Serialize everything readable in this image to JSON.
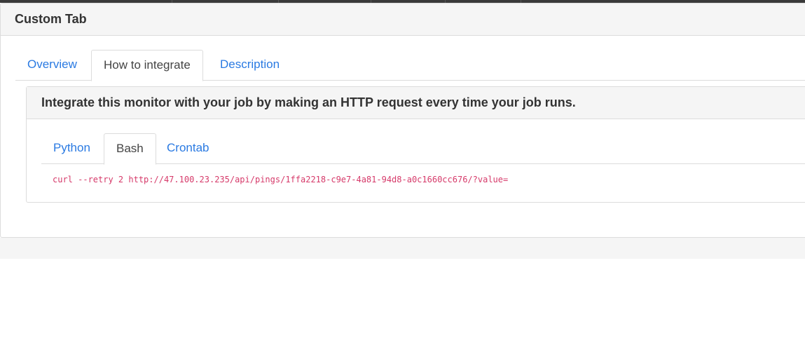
{
  "panel": {
    "title": "Custom Tab"
  },
  "tabs": [
    {
      "label": "Overview",
      "active": false
    },
    {
      "label": "How to integrate",
      "active": true
    },
    {
      "label": "Description",
      "active": false
    }
  ],
  "integration": {
    "heading": "Integrate this monitor with your job by making an HTTP request every time your job runs.",
    "subtabs": [
      {
        "label": "Python",
        "active": false
      },
      {
        "label": "Bash",
        "active": true
      },
      {
        "label": "Crontab",
        "active": false
      }
    ],
    "code": "curl --retry 2 http://47.100.23.235/api/pings/1ffa2218-c9e7-4a81-94d8-a0c1660cc676/?value="
  },
  "colors": {
    "link": "#2a7ae2",
    "code": "#d63a6a",
    "header_bg": "#f5f5f5",
    "border": "#dcdcdc"
  }
}
